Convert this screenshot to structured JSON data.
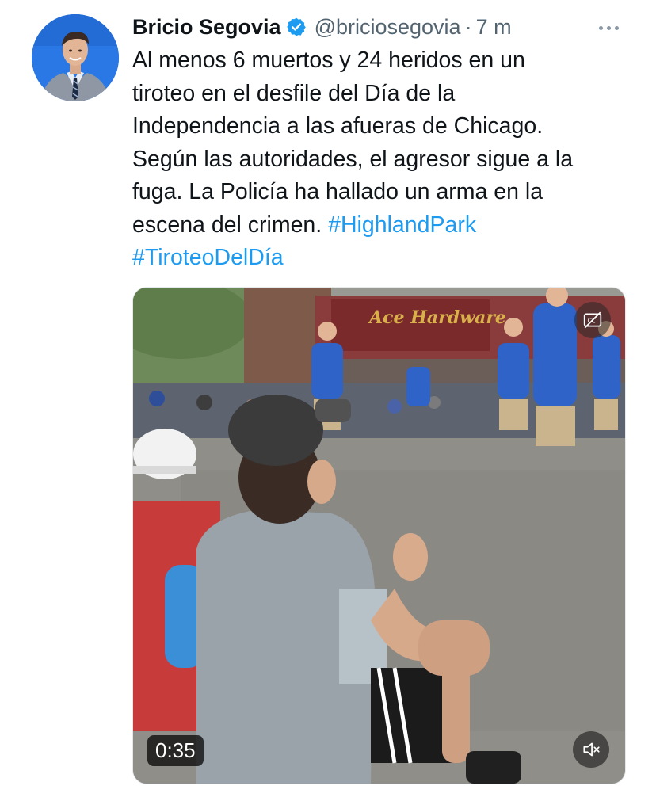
{
  "author": {
    "display_name": "Bricio Segovia",
    "handle": "@briciosegovia",
    "separator": "·",
    "timestamp": "7 m",
    "verified": true
  },
  "tweet": {
    "lines": [
      "Al menos 6 muertos y 24 heridos en un",
      "tiroteo en el desfile del Día de la",
      "Independencia a las afueras de Chicago.",
      "Según las autoridades, el agresor sigue a la",
      "fuga. La Policía ha hallado un arma en la",
      "escena del crimen."
    ],
    "hashtags": [
      "#HighlandPark",
      "#TiroteoDelDía"
    ]
  },
  "video": {
    "duration": "0:35",
    "store_sign": "Ace Hardware"
  },
  "colors": {
    "text": "#0f1419",
    "secondary": "#536471",
    "link": "#1d9bf0",
    "verified_badge": "#1d9bf0"
  },
  "icons": {
    "verified": "verified-badge-icon",
    "more": "more-options-icon",
    "captions": "captions-off-icon",
    "mute": "volume-muted-icon"
  }
}
